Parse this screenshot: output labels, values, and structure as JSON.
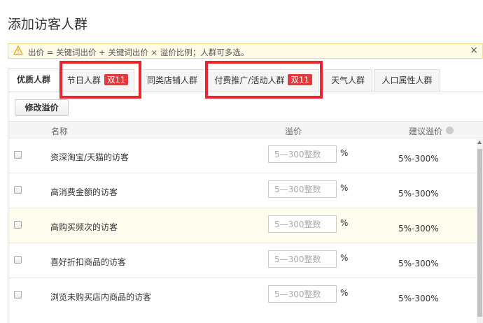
{
  "page": {
    "title": "添加访客人群"
  },
  "notice": {
    "text": "出价 = 关键词出价 + 关键词出价 × 溢价比例；人群可多选。",
    "close": "×",
    "icon": "warning-icon"
  },
  "tabs": [
    {
      "label": "优质人群",
      "badge": "",
      "active": true
    },
    {
      "label": "节日人群",
      "badge": "双11",
      "active": false
    },
    {
      "label": "同类店铺人群",
      "badge": "",
      "active": false
    },
    {
      "label": "付费推广/活动人群",
      "badge": "双11",
      "active": false
    },
    {
      "label": "天气人群",
      "badge": "",
      "active": false
    },
    {
      "label": "人口属性人群",
      "badge": "",
      "active": false
    }
  ],
  "toolbar": {
    "modify_label": "修改溢价"
  },
  "table": {
    "headers": {
      "name": "名称",
      "rate": "溢价",
      "suggest": "建议溢价"
    },
    "rows": [
      {
        "name": "资深淘宝/天猫的访客",
        "placeholder": "5—300整数",
        "unit": "%",
        "suggest": "5%-300%"
      },
      {
        "name": "高消费金额的访客",
        "placeholder": "5—300整数",
        "unit": "%",
        "suggest": "5%-300%"
      },
      {
        "name": "高购买频次的访客",
        "placeholder": "5—300整数",
        "unit": "%",
        "suggest": "5%-300%"
      },
      {
        "name": "喜好折扣商品的访客",
        "placeholder": "5—300整数",
        "unit": "%",
        "suggest": "5%-300%"
      },
      {
        "name": "浏览未购买店内商品的访客",
        "placeholder": "5—300整数",
        "unit": "%",
        "suggest": "5%-300%"
      }
    ]
  },
  "colors": {
    "accent_red": "#e4393c",
    "highlight_border": "#e8262c",
    "notice_bg": "#fffbe6",
    "row_hover": "#fffdee"
  }
}
